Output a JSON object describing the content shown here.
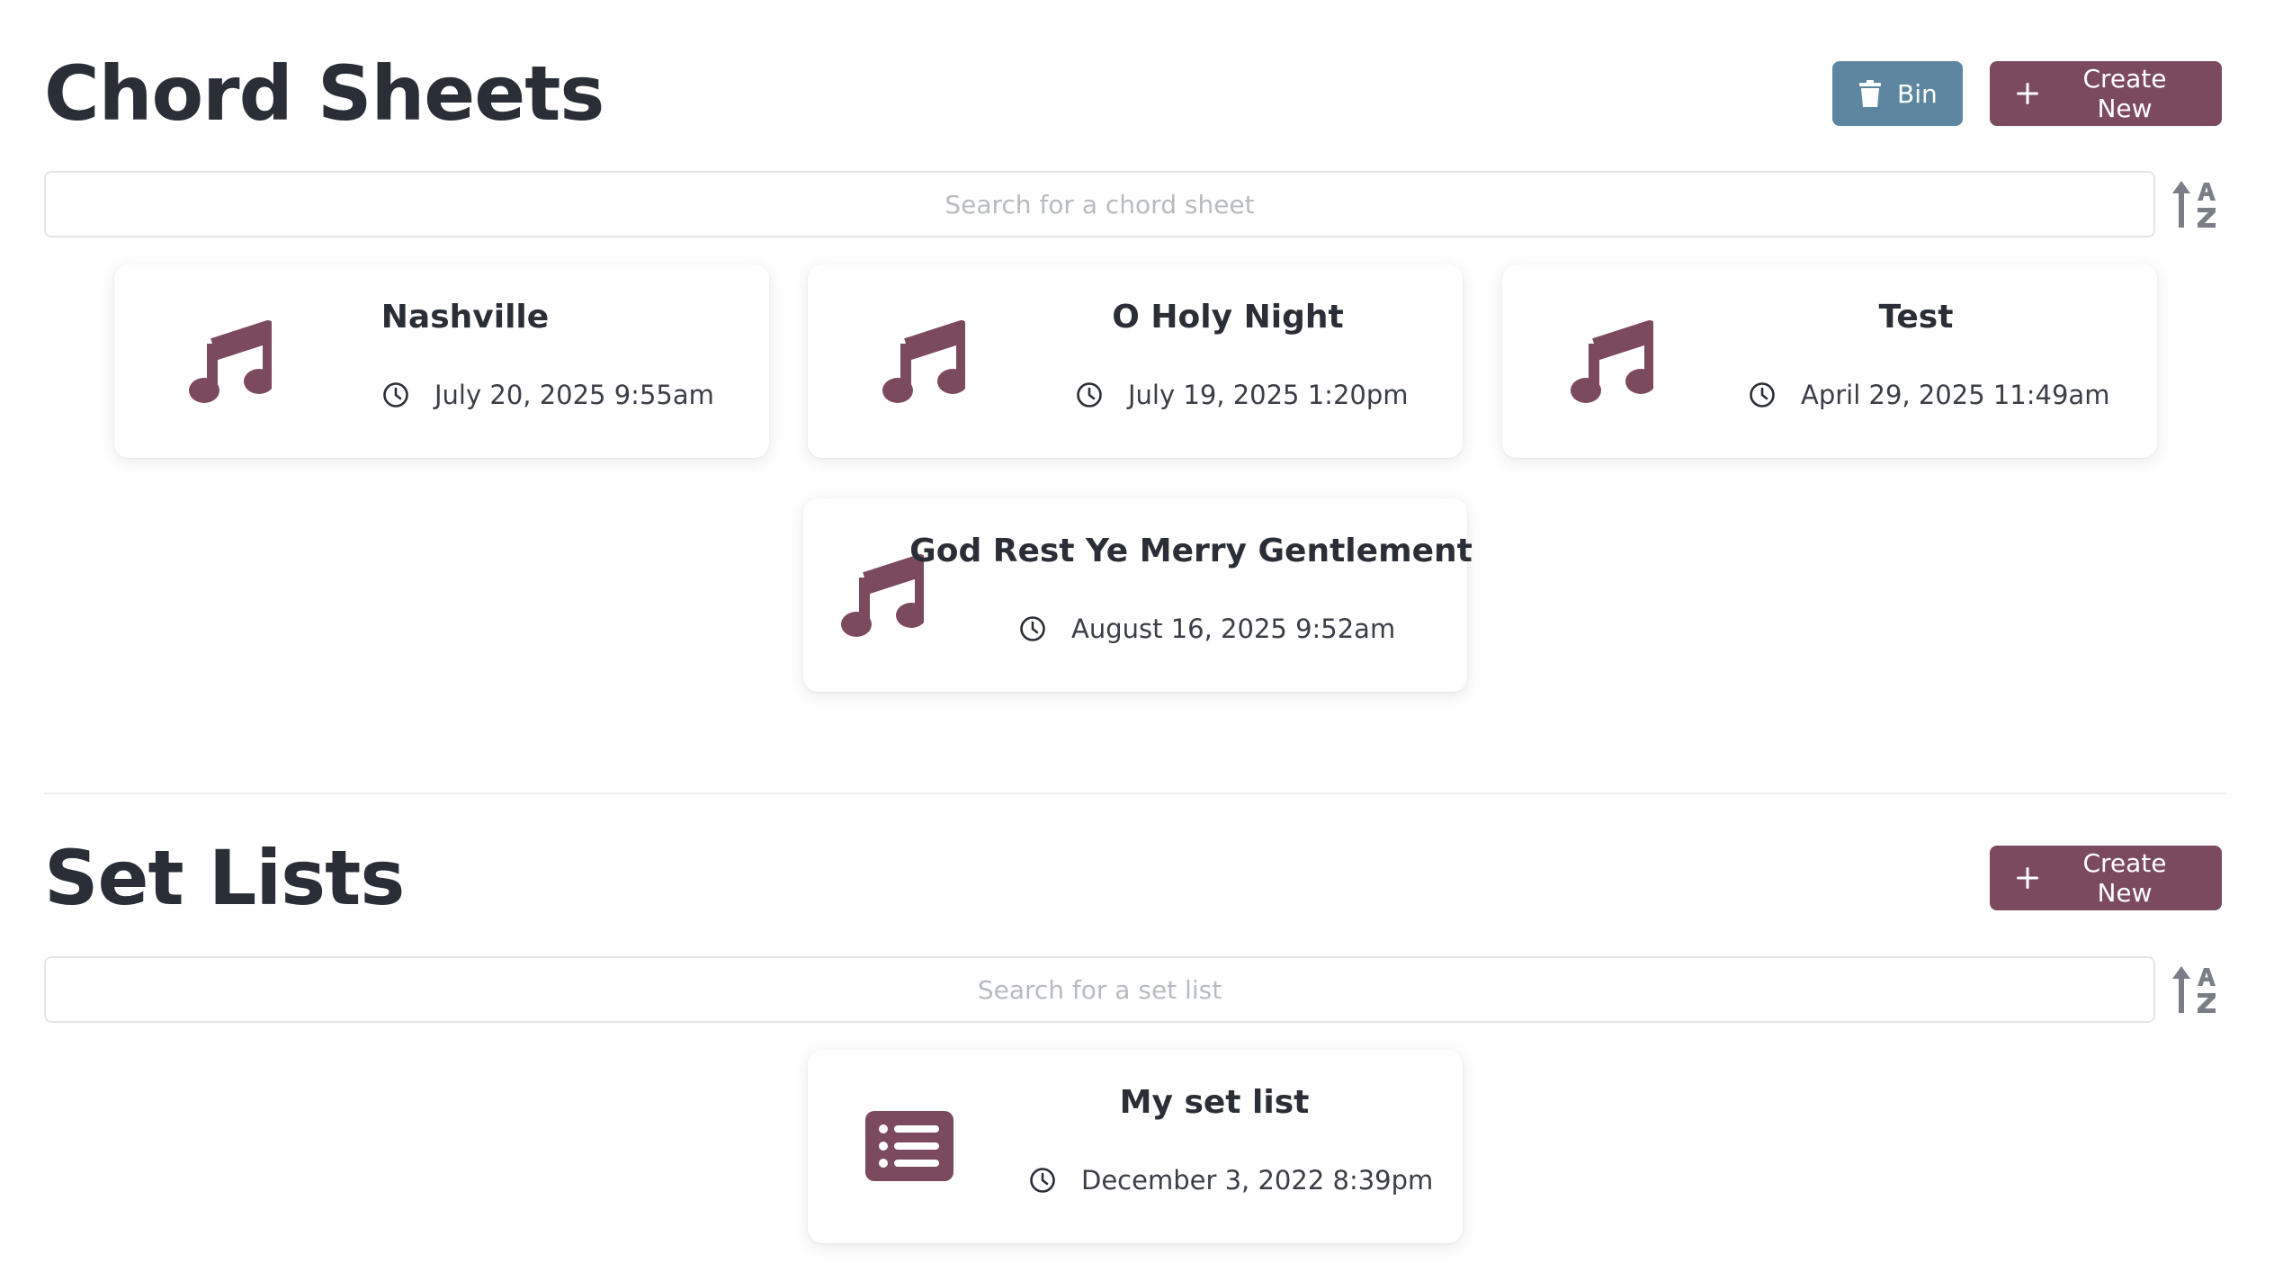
{
  "chord_sheets": {
    "title": "Chord Sheets",
    "bin_label": "Bin",
    "create_label": "Create New",
    "search_placeholder": "Search for a chord sheet",
    "items": [
      {
        "title": "Nashville",
        "date": "July 20, 2025 9:55am"
      },
      {
        "title": "O Holy Night",
        "date": "July 19, 2025 1:20pm"
      },
      {
        "title": "Test",
        "date": "April 29, 2025 11:49am"
      },
      {
        "title": "God Rest Ye Merry Gentlement",
        "date": "August 16, 2025 9:52am"
      }
    ]
  },
  "set_lists": {
    "title": "Set Lists",
    "create_label": "Create New",
    "search_placeholder": "Search for a set list",
    "items": [
      {
        "title": "My set list",
        "date": "December 3, 2022 8:39pm"
      }
    ]
  },
  "colors": {
    "accent": "#7c4a5f",
    "bin": "#5d87a1",
    "text": "#2a2e36"
  },
  "icons": {
    "chord_sheet": "music-note-icon",
    "set_list": "list-icon",
    "date": "clock-icon",
    "sort": "sort-alpha-icon",
    "bin": "trash-icon",
    "create": "plus-icon"
  }
}
